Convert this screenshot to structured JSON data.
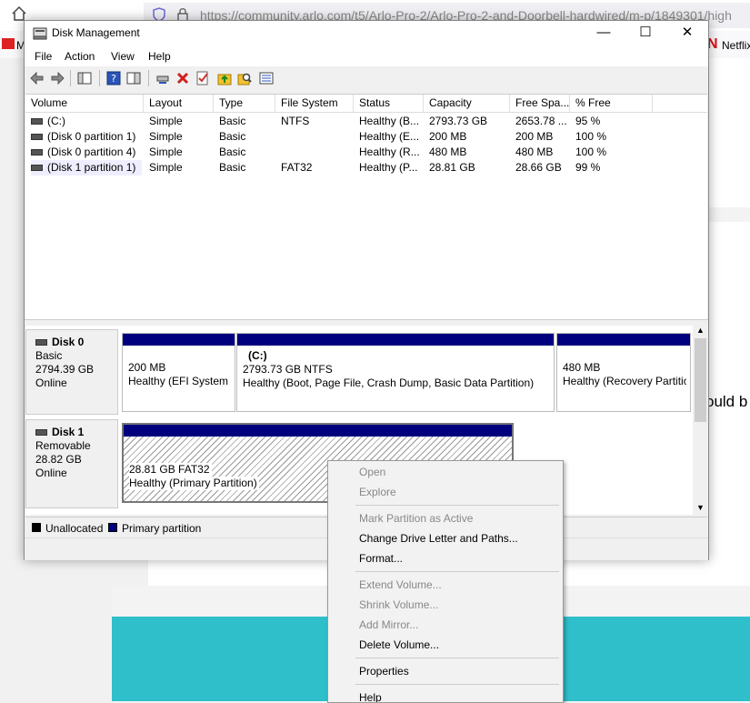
{
  "browser": {
    "url": "https://community.arlo.com/t5/Arlo-Pro-2/Arlo-Pro-2-and-Doorbell-hardwired/m-p/1849301/high",
    "bookmark_left": "M",
    "bookmark_netflix": "Netflix",
    "page_partial_text": "ould b"
  },
  "window": {
    "title": "Disk Management",
    "minimize": "—",
    "maximize": "☐",
    "close": "✕"
  },
  "menu": [
    "File",
    "Action",
    "View",
    "Help"
  ],
  "volume_table": {
    "headers": [
      "Volume",
      "Layout",
      "Type",
      "File System",
      "Status",
      "Capacity",
      "Free Spa...",
      "% Free"
    ],
    "rows": [
      [
        "(C:)",
        "Simple",
        "Basic",
        "NTFS",
        "Healthy (B...",
        "2793.73 GB",
        "2653.78 ...",
        "95 %"
      ],
      [
        "(Disk 0 partition 1)",
        "Simple",
        "Basic",
        "",
        "Healthy (E...",
        "200 MB",
        "200 MB",
        "100 %"
      ],
      [
        "(Disk 0 partition 4)",
        "Simple",
        "Basic",
        "",
        "Healthy (R...",
        "480 MB",
        "480 MB",
        "100 %"
      ],
      [
        "(Disk 1 partition 1)",
        "Simple",
        "Basic",
        "FAT32",
        "Healthy (P...",
        "28.81 GB",
        "28.66 GB",
        "99 %"
      ]
    ]
  },
  "disks": [
    {
      "name": "Disk 0",
      "type": "Basic",
      "size": "2794.39 GB",
      "state": "Online",
      "partitions": [
        {
          "label": "",
          "line1": "200 MB",
          "line2": "Healthy (EFI System Partition)"
        },
        {
          "label": "(C:)",
          "line1": "2793.73 GB NTFS",
          "line2": "Healthy (Boot, Page File, Crash Dump, Basic Data Partition)"
        },
        {
          "label": "",
          "line1": "480 MB",
          "line2": "Healthy (Recovery Partition)"
        }
      ]
    },
    {
      "name": "Disk 1",
      "type": "Removable",
      "size": "28.82 GB",
      "state": "Online",
      "partitions": [
        {
          "label": "",
          "line1": "28.81 GB FAT32",
          "line2": "Healthy (Primary Partition)"
        }
      ]
    }
  ],
  "legend": {
    "unallocated": "Unallocated",
    "primary": "Primary partition"
  },
  "context_menu": {
    "open": "Open",
    "explore": "Explore",
    "mark_active": "Mark Partition as Active",
    "change_letter": "Change Drive Letter and Paths...",
    "format": "Format...",
    "extend": "Extend Volume...",
    "shrink": "Shrink Volume...",
    "add_mirror": "Add Mirror...",
    "delete": "Delete Volume...",
    "properties": "Properties",
    "help": "Help"
  },
  "colors": {
    "primary_partition": "#00007f",
    "unallocated": "#000000",
    "teal_banner": "#2fbfcb"
  }
}
